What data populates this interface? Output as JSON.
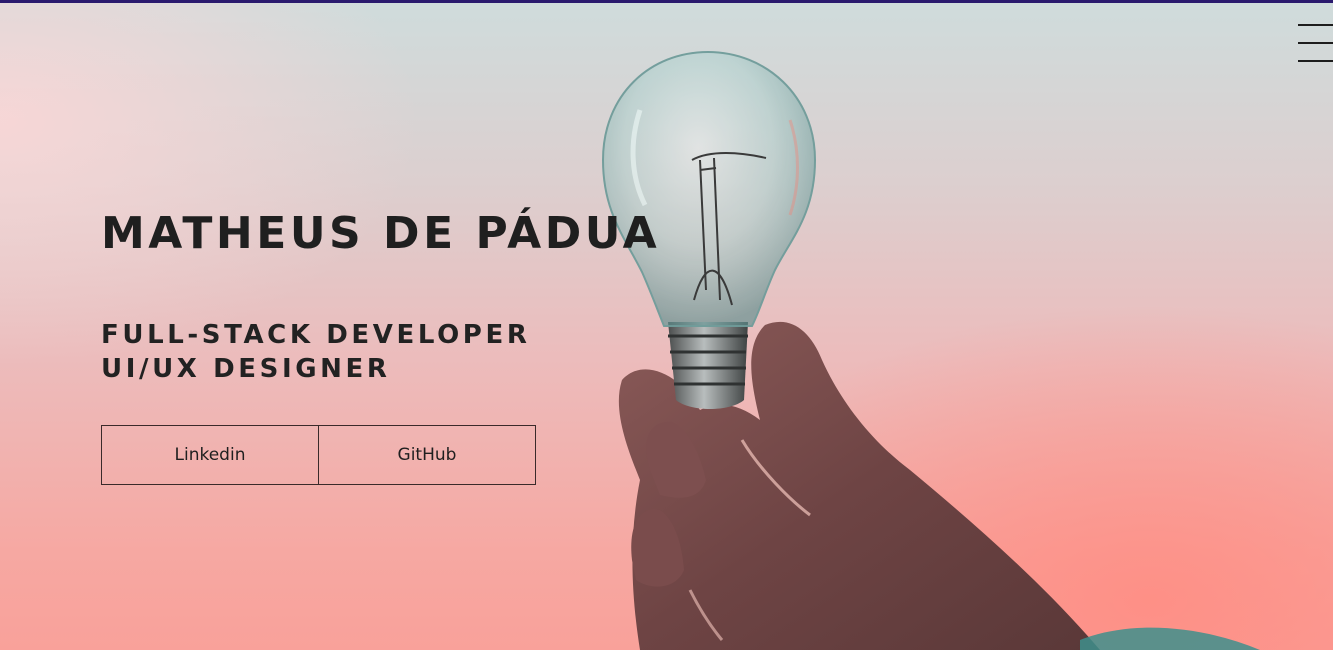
{
  "hero": {
    "name": "MATHEUS DE PÁDUA",
    "roles": [
      "FULL-STACK DEVELOPER",
      "UI/UX DESIGNER"
    ],
    "background_image": "hand-holding-light-bulb"
  },
  "buttons": {
    "linkedin_label": "Linkedin",
    "github_label": "GitHub"
  },
  "menu": {
    "icon": "hamburger-menu-icon"
  },
  "colors": {
    "text": "#1f1f1f",
    "top_border": "#2a1a6e",
    "sky_top": "#cfdcdc",
    "sky_bottom": "#f9a19a"
  }
}
